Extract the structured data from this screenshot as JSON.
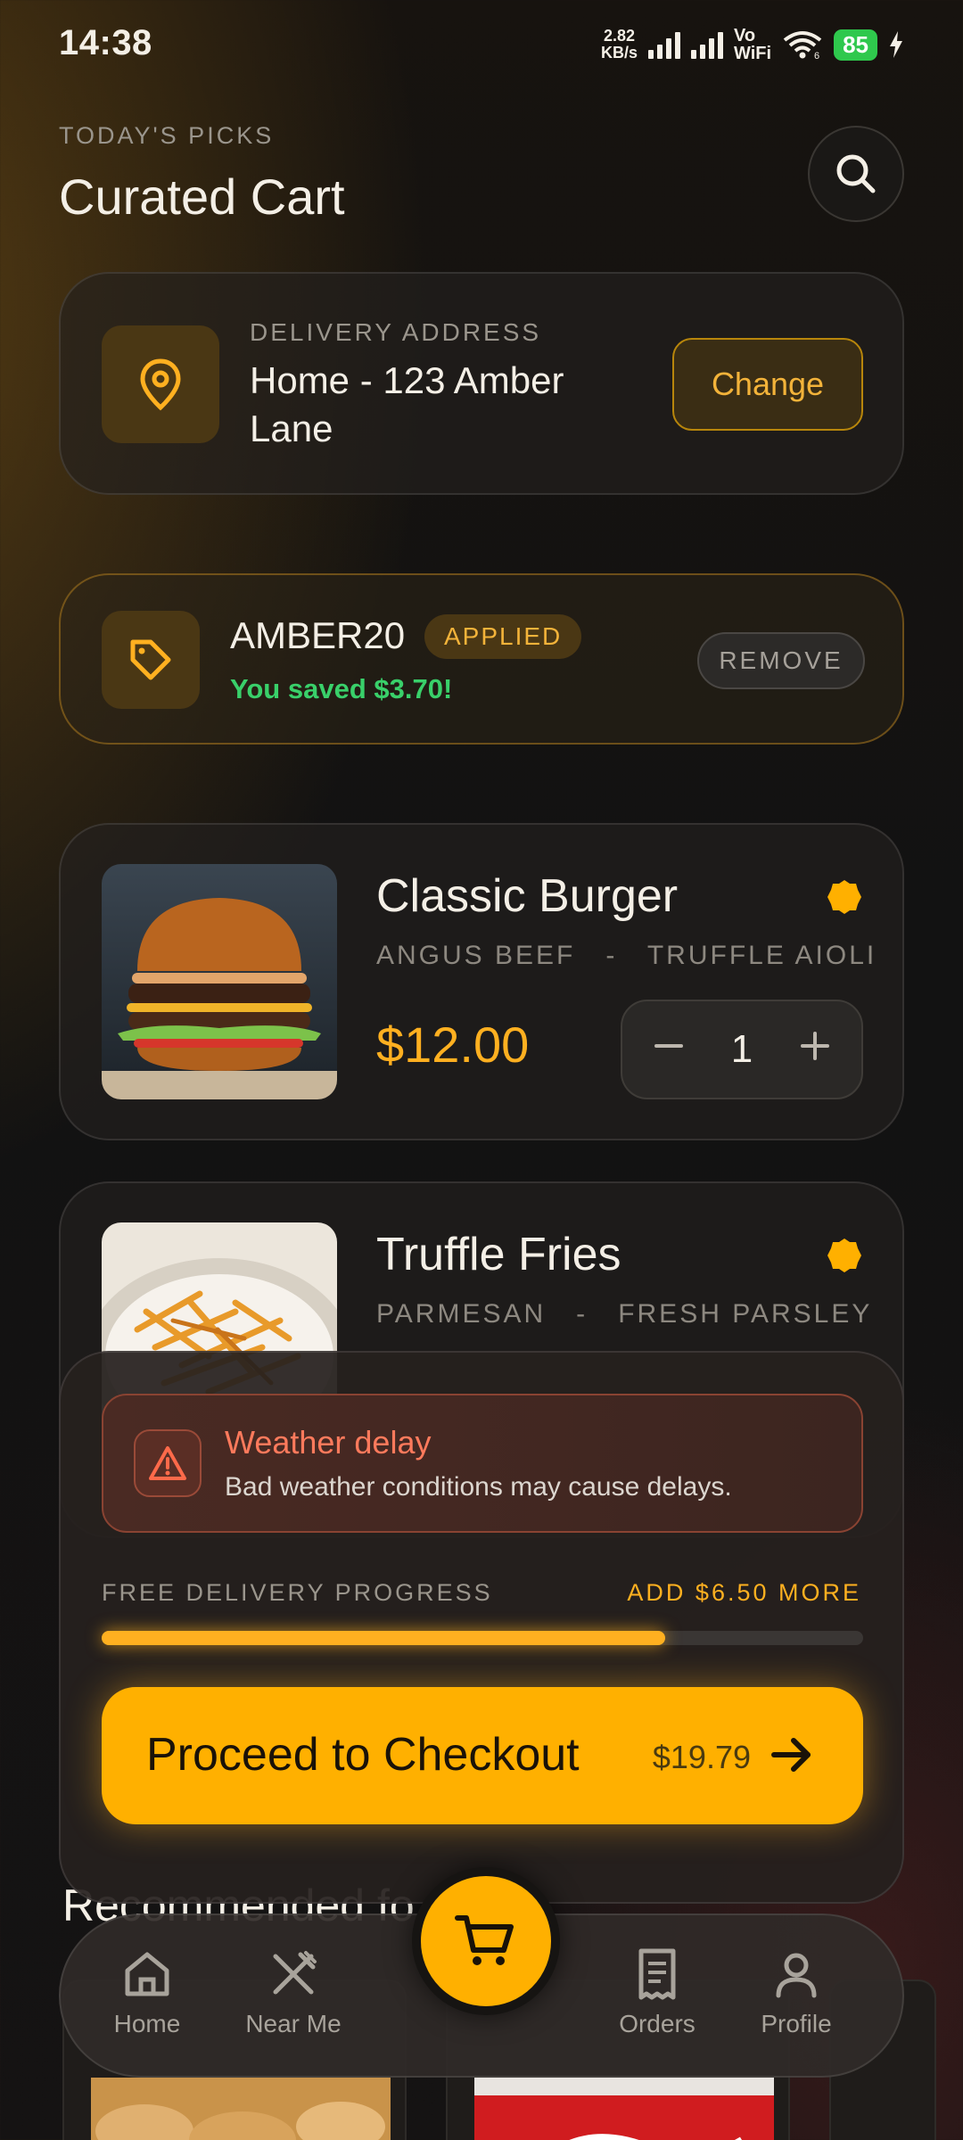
{
  "status_bar": {
    "time": "14:38",
    "net_speed_value": "2.82",
    "net_speed_unit": "KB/s",
    "vowifi_top": "Vo",
    "vowifi_bottom": "WiFi",
    "battery": "85",
    "wifi_label": "6"
  },
  "header": {
    "eyebrow": "TODAY'S PICKS",
    "title": "Curated Cart"
  },
  "address": {
    "label": "DELIVERY ADDRESS",
    "value": "Home - 123 Amber Lane",
    "change_label": "Change"
  },
  "promo": {
    "code": "AMBER20",
    "badge": "APPLIED",
    "saved": "You saved $3.70!",
    "remove_label": "REMOVE"
  },
  "items": [
    {
      "name": "Classic Burger",
      "desc_1": "ANGUS BEEF",
      "desc_sep": "-",
      "desc_2": "TRUFFLE AIOLI",
      "price": "$12.00",
      "quantity": "1"
    },
    {
      "name": "Truffle Fries",
      "desc_1": "PARMESAN",
      "desc_sep": "-",
      "desc_2": "FRESH PARSLEY"
    }
  ],
  "alert": {
    "title": "Weather delay",
    "text": "Bad weather conditions may cause delays."
  },
  "delivery_progress": {
    "label": "FREE DELIVERY PROGRESS",
    "hint": "ADD $6.50 MORE",
    "fraction": 0.74
  },
  "checkout": {
    "label": "Proceed to Checkout",
    "total": "$19.79"
  },
  "recommended": {
    "title": "Recommended fo"
  },
  "nav": {
    "items": [
      {
        "label": "Home",
        "icon": "home-icon"
      },
      {
        "label": "Near Me",
        "icon": "utensils-icon"
      },
      {
        "label": "Orders",
        "icon": "receipt-icon"
      },
      {
        "label": "Profile",
        "icon": "user-icon"
      }
    ],
    "center_icon": "cart-icon"
  },
  "colors": {
    "accent": "#ffb000",
    "success": "#39d06a",
    "warning": "#ff7a5c"
  }
}
